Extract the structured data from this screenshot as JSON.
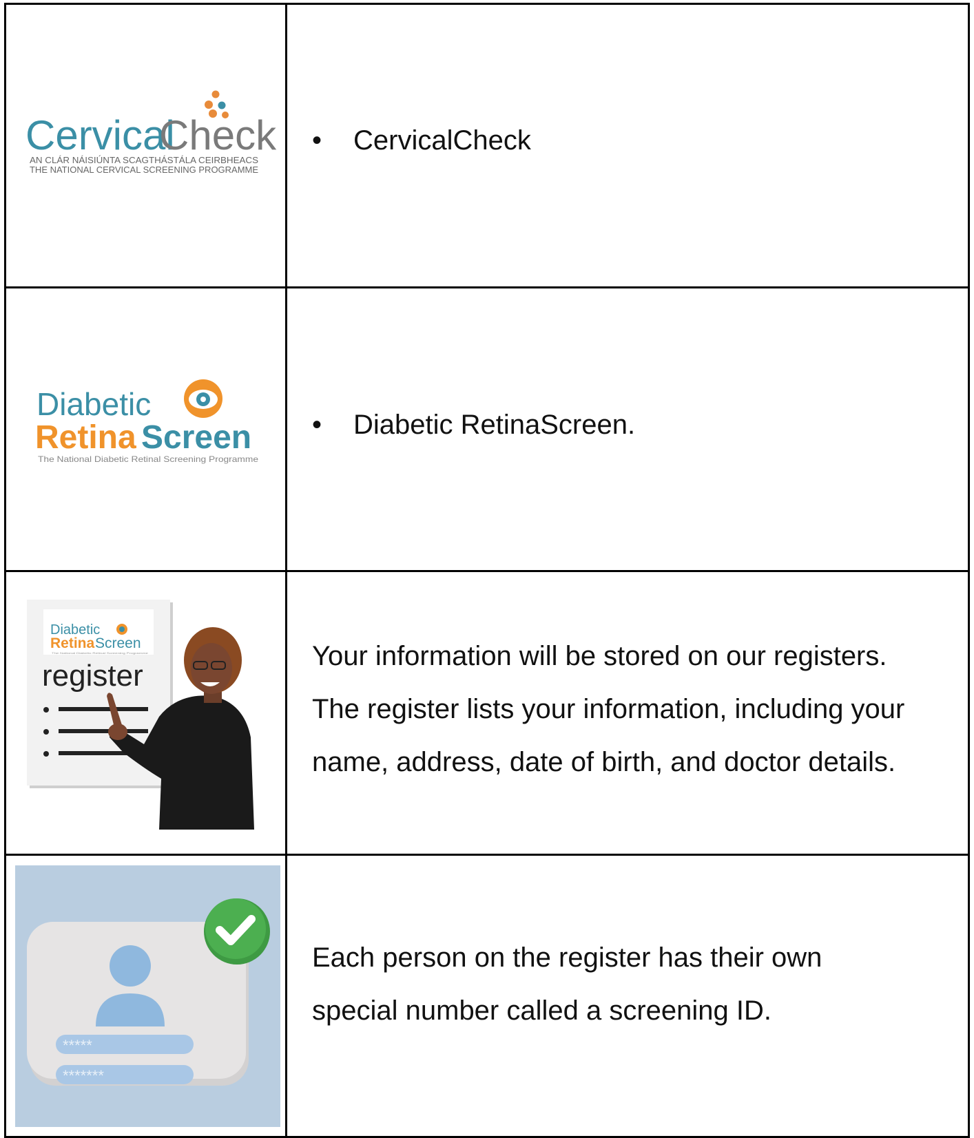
{
  "rows": [
    {
      "logo": {
        "icon": "cervicalcheck-logo",
        "name_part1": "Cervical",
        "name_part2": "Check",
        "tagline_irish": "AN CLÁR NÁISIÚNTA SCAGTHÁSTÁLA CEIRBHEACS",
        "tagline_english": "THE NATIONAL CERVICAL SCREENING PROGRAMME",
        "colors": {
          "teal": "#3b8fa6",
          "grey": "#7a7a7a",
          "orange": "#e88b3a"
        }
      },
      "bullet": "•",
      "text": "CervicalCheck"
    },
    {
      "logo": {
        "icon": "diabetic-retinascreen-logo",
        "line1": "Diabetic",
        "line2_part1": "Retina",
        "line2_part2": "Screen",
        "tagline": "The National Diabetic Retinal Screening Programme",
        "colors": {
          "teal": "#3b8fa6",
          "orange": "#f0932b"
        }
      },
      "bullet": "•",
      "text": "Diabetic RetinaScreen."
    },
    {
      "illustration": {
        "icon": "register-presenter-illustration",
        "logo_line1": "Diabetic",
        "logo_line2_part1": "Retina",
        "logo_line2_part2": "Screen",
        "logo_tagline": "The National Diabetic Retinal Screening Programme",
        "board_word": "register"
      },
      "text_lines": [
        "Your information will be stored on our registers.",
        "The register lists your information, including your",
        "name, address, date of birth, and doctor details."
      ]
    },
    {
      "illustration": {
        "icon": "id-card-check-illustration",
        "field1_mask": "*****",
        "field2_mask": "*******",
        "colors": {
          "bg": "#b9cde0",
          "card": "#e6e4e4",
          "check": "#4caf50",
          "person": "#8fb8de"
        }
      },
      "text_lines": [
        "Each person on the register has their own",
        "special number called a screening ID."
      ]
    }
  ]
}
